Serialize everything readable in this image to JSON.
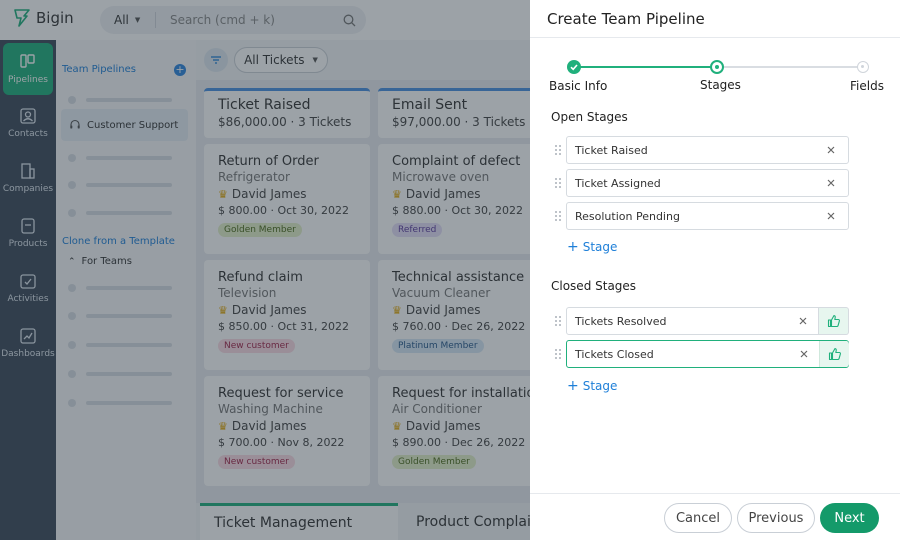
{
  "app": {
    "name": "Bigin",
    "search_scope": "All",
    "search_placeholder": "Search (cmd + k)"
  },
  "sidenav": {
    "items": [
      {
        "label": "Pipelines",
        "icon": "pipelines-icon"
      },
      {
        "label": "Contacts",
        "icon": "contacts-icon"
      },
      {
        "label": "Companies",
        "icon": "companies-icon"
      },
      {
        "label": "Products",
        "icon": "products-icon"
      },
      {
        "label": "Activities",
        "icon": "activities-icon"
      },
      {
        "label": "Dashboards",
        "icon": "dashboards-icon"
      }
    ]
  },
  "subnav": {
    "heading": "Team Pipelines",
    "active_item": "Customer Support",
    "clone_label": "Clone from a Template",
    "for_teams": "For Teams"
  },
  "board": {
    "filter_label": "All Tickets",
    "columns": [
      {
        "title": "Ticket Raised",
        "amount": "$86,000.00",
        "count": "3 Tickets",
        "cards": [
          {
            "title": "Return of Order",
            "product": "Refrigerator",
            "owner": "David James",
            "amount": "$ 800.00",
            "date": "Oct 30, 2022",
            "tag": "Golden Member",
            "tag_color": "#e4f0c8",
            "tag_text": "#4c6a1a"
          },
          {
            "title": "Refund claim",
            "product": "Television",
            "owner": "David James",
            "amount": "$ 850.00",
            "date": "Oct 31, 2022",
            "tag": "New customer",
            "tag_color": "#fbdbe3",
            "tag_text": "#a3264b"
          },
          {
            "title": "Request for service",
            "product": "Washing Machine",
            "owner": "David James",
            "amount": "$ 700.00",
            "date": "Nov 8, 2022",
            "tag": "New customer",
            "tag_color": "#fbdbe3",
            "tag_text": "#a3264b"
          }
        ]
      },
      {
        "title": "Email Sent",
        "amount": "$97,000.00",
        "count": "3 Tickets",
        "cards": [
          {
            "title": "Complaint of defect",
            "product": "Microwave oven",
            "owner": "David James",
            "amount": "$ 880.00",
            "date": "Oct 30, 2022",
            "tag": "Referred",
            "tag_color": "#e6def7",
            "tag_text": "#5b3b9e"
          },
          {
            "title": "Technical assistance",
            "product": "Vacuum Cleaner",
            "owner": "David James",
            "amount": "$ 760.00",
            "date": "Dec 26, 2022",
            "tag": "Platinum Member",
            "tag_color": "#d7e8f6",
            "tag_text": "#27588a"
          },
          {
            "title": "Request for installation",
            "product": "Air Conditioner",
            "owner": "David James",
            "amount": "$ 890.00",
            "date": "Dec 26, 2022",
            "tag": "Golden Member",
            "tag_color": "#e4f0c8",
            "tag_text": "#4c6a1a"
          }
        ]
      }
    ],
    "bottom_tabs": [
      "Ticket Management",
      "Product Complaints"
    ]
  },
  "drawer": {
    "title": "Create Team Pipeline",
    "steps": [
      {
        "label": "Basic Info",
        "state": "done"
      },
      {
        "label": "Stages",
        "state": "current"
      },
      {
        "label": "Fields",
        "state": "upcoming"
      }
    ],
    "open_stages_label": "Open Stages",
    "open_stages": [
      "Ticket Raised",
      "Ticket Assigned",
      "Resolution Pending"
    ],
    "closed_stages_label": "Closed Stages",
    "closed_stages": [
      "Tickets Resolved",
      "Tickets Closed"
    ],
    "add_stage_label": "Stage",
    "buttons": {
      "cancel": "Cancel",
      "previous": "Previous",
      "next": "Next"
    }
  },
  "colors": {
    "accent": "#20b07c",
    "primary_button": "#149a6a",
    "link": "#1e7fd8"
  }
}
